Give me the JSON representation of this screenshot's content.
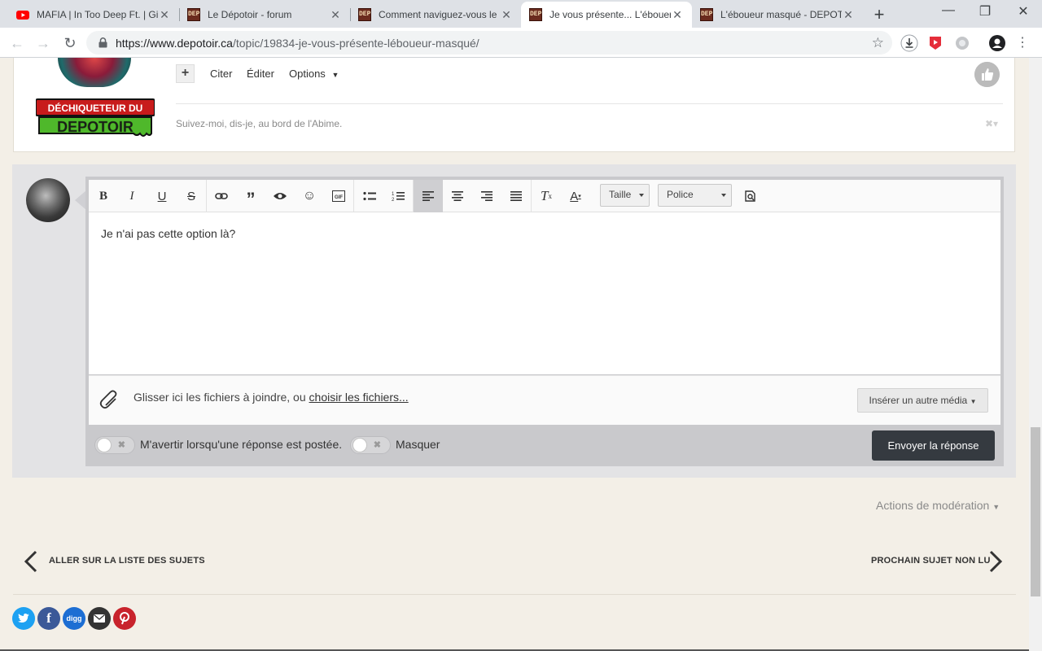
{
  "browser": {
    "tabs": [
      {
        "title": "MAFIA | In Too Deep Ft. | Gi",
        "favicon": "youtube-icon"
      },
      {
        "title": "Le Dépotoir - forum",
        "favicon": "depotoir-icon"
      },
      {
        "title": "Comment naviguez-vous le",
        "favicon": "depotoir-icon"
      },
      {
        "title": "Je vous présente... L'ébouer",
        "favicon": "depotoir-icon",
        "active": true
      },
      {
        "title": "L'éboueur masqué - DEPOT",
        "favicon": "depotoir-icon"
      }
    ],
    "favicon_text": "DEP",
    "url_host": "https://www.depotoir.ca",
    "url_path": "/topic/19834-je-vous-présente-léboueur-masqué/"
  },
  "post": {
    "plus_label": "+",
    "quote_label": "Citer",
    "edit_label": "Éditer",
    "options_label": "Options",
    "badge_line1": "DÉCHIQUETEUR DU",
    "badge_line2": "DEPOTOIR",
    "signature": "Suivez-moi, dis-je, au bord de l'Abime."
  },
  "editor": {
    "size_select": "Taille",
    "font_select": "Police",
    "content": "Je n'ai pas cette option là?",
    "attach_text": "Glisser ici les fichiers à joindre, ou ",
    "attach_link": "choisir les fichiers...",
    "insert_media": "Insérer un autre média",
    "notify_label": "M'avertir lorsqu'une réponse est postée.",
    "hide_label": "Masquer",
    "submit_label": "Envoyer la réponse"
  },
  "footer": {
    "moderation_label": "Actions de modération",
    "prev_label": "ALLER SUR LA LISTE DES SUJETS",
    "next_label": "PROCHAIN SUJET NON LU",
    "share": [
      {
        "name": "twitter-icon",
        "color": "#1da1f2"
      },
      {
        "name": "facebook-icon",
        "color": "#3b5998"
      },
      {
        "name": "digg-icon",
        "color": "#1d6ed3"
      },
      {
        "name": "email-icon",
        "color": "#333333"
      },
      {
        "name": "pinterest-icon",
        "color": "#c8232c"
      }
    ]
  },
  "colors": {
    "page_background": "#f3efe7",
    "submit_button": "#353a40",
    "reply_panel": "#e3e3e5"
  }
}
